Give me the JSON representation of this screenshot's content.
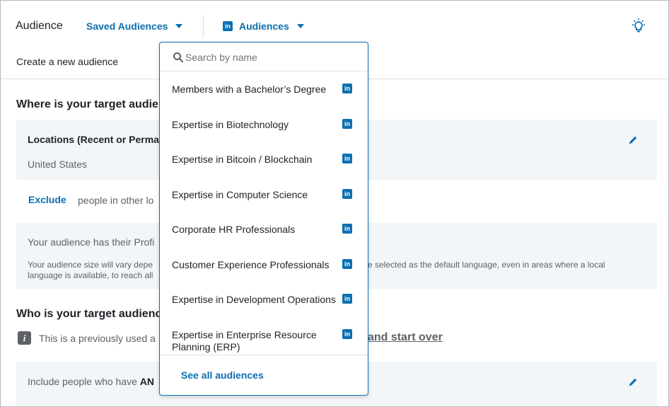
{
  "header": {
    "title": "Audience",
    "saved_audiences_label": "Saved Audiences",
    "audiences_label": "Audiences",
    "create_label": "Create a new audience"
  },
  "location_section": {
    "title": "Where is your target audien",
    "locations_label": "Locations (Recent or Perma",
    "locations_value": "United States",
    "exclude_label": "Exclude",
    "exclude_rest": "people in other lo",
    "profile_text": "Your audience has their Profi",
    "profile_small_1": "Your audience size will vary depe",
    "profile_small_2": "language is available, to reach all",
    "profile_small_3": "e selected as the default language, even in areas where a local"
  },
  "who_section": {
    "title": "Who is your target audienc",
    "prev_used": "This is a previously used a",
    "start_over": "and start over",
    "include_prefix": "Include people who have ",
    "include_bold": "AN"
  },
  "dropdown": {
    "search_placeholder": "Search by name",
    "items": [
      {
        "label": "Members with a Bachelor’s Degree"
      },
      {
        "label": "Expertise in Biotechnology"
      },
      {
        "label": "Expertise in Bitcoin / Blockchain"
      },
      {
        "label": "Expertise in Computer Science"
      },
      {
        "label": "Corporate HR Professionals"
      },
      {
        "label": "Customer Experience Professionals"
      },
      {
        "label": "Expertise in Development Operations"
      },
      {
        "label": "Expertise in Enterprise Resource Planning (ERP)"
      }
    ],
    "see_all": "See all audiences",
    "linkedin_glyph": "in"
  },
  "colors": {
    "accent": "#0b6fb0",
    "panel_bg": "#f3f6f8",
    "muted_text": "#5e6266"
  }
}
